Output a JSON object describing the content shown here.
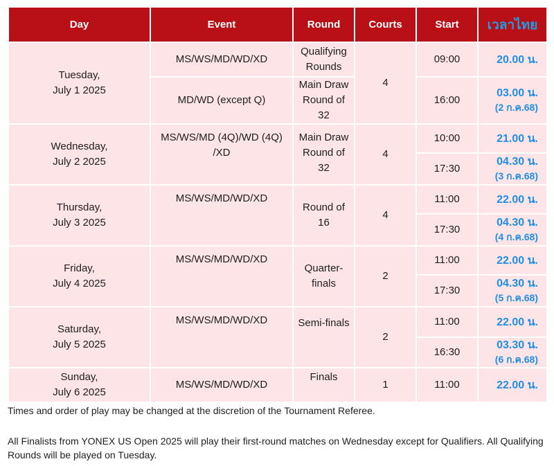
{
  "headers": {
    "day": "Day",
    "event": "Event",
    "round": "Round",
    "courts": "Courts",
    "start": "Start",
    "thai_time": "เวลาไทย"
  },
  "rows": [
    {
      "day_line1": "Tuesday,",
      "day_line2": "July 1 2025",
      "courts": "4",
      "sessions": [
        {
          "event": "MS/WS/MD/WD/XD",
          "round": "Qualifying Rounds",
          "start": "09:00",
          "thai": "20.00 น.",
          "thai_sub": ""
        },
        {
          "event": "MD/WD (except Q)",
          "round": "Main Draw Round of 32",
          "start": "16:00",
          "thai": "03.00 น.",
          "thai_sub": "(2 ก.ค.68)"
        }
      ]
    },
    {
      "day_line1": "Wednesday,",
      "day_line2": "July 2 2025",
      "event": "MS/WS/MD (4Q)/WD (4Q) /XD",
      "round": "Main Draw Round of 32",
      "courts": "4",
      "sessions": [
        {
          "start": "10:00",
          "thai": "21.00 น.",
          "thai_sub": ""
        },
        {
          "start": "17:30",
          "thai": "04.30 น.",
          "thai_sub": "(3 ก.ค.68)"
        }
      ]
    },
    {
      "day_line1": "Thursday,",
      "day_line2": "July 3 2025",
      "event": "MS/WS/MD/WD/XD",
      "round": "Round of 16",
      "courts": "4",
      "sessions": [
        {
          "start": "11:00",
          "thai": "22.00 น.",
          "thai_sub": ""
        },
        {
          "start": "17:30",
          "thai": "04.30 น.",
          "thai_sub": "(4 ก.ค.68)"
        }
      ]
    },
    {
      "day_line1": "Friday,",
      "day_line2": "July 4 2025",
      "event": "MS/WS/MD/WD/XD",
      "round": "Quarter-finals",
      "courts": "2",
      "sessions": [
        {
          "start": "11:00",
          "thai": "22.00 น.",
          "thai_sub": ""
        },
        {
          "start": "17:30",
          "thai": "04.30 น.",
          "thai_sub": "(5 ก.ค.68)"
        }
      ]
    },
    {
      "day_line1": "Saturday,",
      "day_line2": "July 5 2025",
      "event": "MS/WS/MD/WD/XD",
      "round": "Semi-finals",
      "courts": "2",
      "sessions": [
        {
          "start": "11:00",
          "thai": "22.00 น.",
          "thai_sub": ""
        },
        {
          "start": "16:30",
          "thai": "03.30 น.",
          "thai_sub": "(6 ก.ค.68)"
        }
      ]
    },
    {
      "day_line1": "Sunday,",
      "day_line2": "July 6 2025",
      "event": "MS/WS/MD/WD/XD",
      "round": "Finals",
      "courts": "1",
      "sessions": [
        {
          "start": "11:00",
          "thai": "22.00 น.",
          "thai_sub": ""
        }
      ]
    }
  ],
  "notes": {
    "note1": "Times and order of play may be changed at the discretion of the Tournament Referee.",
    "note2": "All Finalists from YONEX US Open 2025 will play their first-round matches on Wednesday except for Qualifiers. All Qualifying Rounds will be played on Tuesday."
  },
  "colors": {
    "header_bg": "#b90f16",
    "cell_bg": "#fde4e6",
    "thai_time": "#1f8fe3"
  }
}
